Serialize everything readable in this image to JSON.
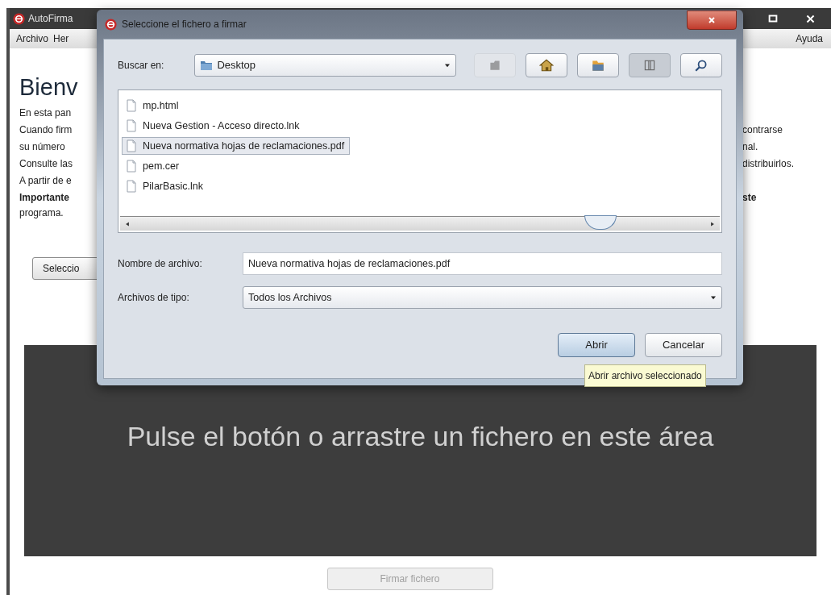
{
  "main_window": {
    "title": "AutoFirma",
    "menu": [
      "Archivo",
      "Her"
    ],
    "help_menu": "Ayuda",
    "heading": "Bienv",
    "intro_lines": [
      {
        "left": "En esta pan",
        "bold": false
      },
      {
        "left": "Cuando firm",
        "right": "contrarse",
        "bold": false
      },
      {
        "left": "su número",
        "right": "nal.",
        "bold": false
      },
      {
        "left": "Consulte las",
        "right": "distribuirlos.",
        "bold": false
      },
      {
        "left": "A partir de e",
        "bold": false
      },
      {
        "left": "Importante",
        "right": "ste",
        "bold": true
      },
      {
        "left": "programa.",
        "bold": false
      }
    ],
    "select_button": "Seleccio",
    "drop_area": "Pulse el botón o arrastre un fichero en este área",
    "sign_button": {
      "label": "Firmar fichero",
      "disabled": true
    }
  },
  "dialog": {
    "title": "Seleccione el fichero a firmar",
    "look_in_label": "Buscar en:",
    "look_in_value": "Desktop",
    "files": [
      {
        "name": "mp.html",
        "selected": false
      },
      {
        "name": "Nueva Gestion - Acceso directo.lnk",
        "selected": false
      },
      {
        "name": "Nueva normativa hojas de reclamaciones.pdf",
        "selected": true
      },
      {
        "name": "pem.cer",
        "selected": false
      },
      {
        "name": "PilarBasic.lnk",
        "selected": false
      }
    ],
    "file_name_label": "Nombre de archivo:",
    "file_name_value": "Nueva normativa hojas de reclamaciones.pdf",
    "file_type_label": "Archivos de tipo:",
    "file_type_value": "Todos los Archivos",
    "buttons": [
      {
        "label": "Abrir",
        "kind": "default"
      },
      {
        "label": "Cancelar",
        "kind": "normal"
      }
    ],
    "tooltip": "Abrir archivo seleccionado"
  }
}
